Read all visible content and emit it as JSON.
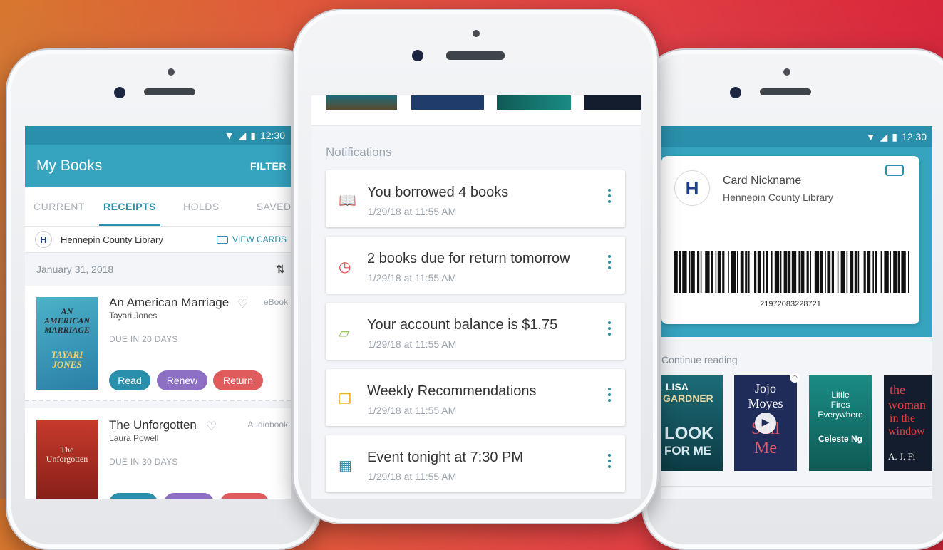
{
  "colors": {
    "accent": "#36a3bf",
    "status_bar": "#2a8fab",
    "read": "#2a8fab",
    "renew": "#8d6fc4",
    "return": "#e05b5b"
  },
  "left": {
    "status_time": "12:30",
    "app_title": "My Books",
    "filter_label": "FILTER",
    "tabs": [
      {
        "label": "CURRENT"
      },
      {
        "label": "RECEIPTS"
      },
      {
        "label": "HOLDS"
      },
      {
        "label": "SAVED"
      }
    ],
    "library_name": "Hennepin County Library",
    "view_cards_label": "VIEW CARDS",
    "date": "January 31, 2018",
    "books": [
      {
        "title": "An American Marriage",
        "author": "Tayari Jones",
        "due": "DUE IN 20 DAYS",
        "type": "eBook",
        "cover_lines": [
          "AN",
          "AMERICAN",
          "MARRIAGE",
          "TAYARI",
          "JONES"
        ],
        "actions": [
          "Read",
          "Renew",
          "Return"
        ]
      },
      {
        "title": "The Unforgotten",
        "author": "Laura Powell",
        "due": "DUE IN 30 DAYS",
        "type": "Audiobook",
        "cover_lines": [
          "The",
          "Unforgotten"
        ],
        "actions": [
          "",
          "",
          ""
        ]
      }
    ]
  },
  "middle": {
    "section_title": "Notifications",
    "notifications": [
      {
        "icon": "book-icon",
        "title": "You borrowed 4 books",
        "time": "1/29/18 at 11:55 AM",
        "color": "#6f5cc4"
      },
      {
        "icon": "clock-icon",
        "title": "2 books due for return tomorrow",
        "time": "1/29/18 at 11:55 AM",
        "color": "#e04848"
      },
      {
        "icon": "wallet-icon",
        "title": "Your account balance is $1.75",
        "time": "1/29/18 at 11:55 AM",
        "color": "#8cc63f"
      },
      {
        "icon": "recommend-icon",
        "title": "Weekly Recommendations",
        "time": "1/29/18 at 11:55 AM",
        "color": "#f0b323"
      },
      {
        "icon": "calendar-icon",
        "title": "Event tonight at 7:30 PM",
        "time": "1/29/18 at 11:55 AM",
        "color": "#2a8fab"
      }
    ]
  },
  "right": {
    "status_time": "12:30",
    "card_nickname": "Card Nickname",
    "library_name": "Hennepin County Library",
    "card_number": "21972083228721",
    "continue_label": "Continue reading",
    "books": [
      {
        "title_lines": [
          "LISA",
          "GARDNER",
          "LOOK",
          "FOR ME"
        ]
      },
      {
        "title_lines": [
          "Jojo",
          "Moyes",
          "Still",
          "Me"
        ]
      },
      {
        "title_lines": [
          "Little",
          "Fires",
          "Everywhere",
          "Celeste Ng"
        ]
      },
      {
        "title_lines": [
          "the",
          "woman",
          "in the",
          "window",
          "A. J. Fi"
        ]
      }
    ]
  }
}
